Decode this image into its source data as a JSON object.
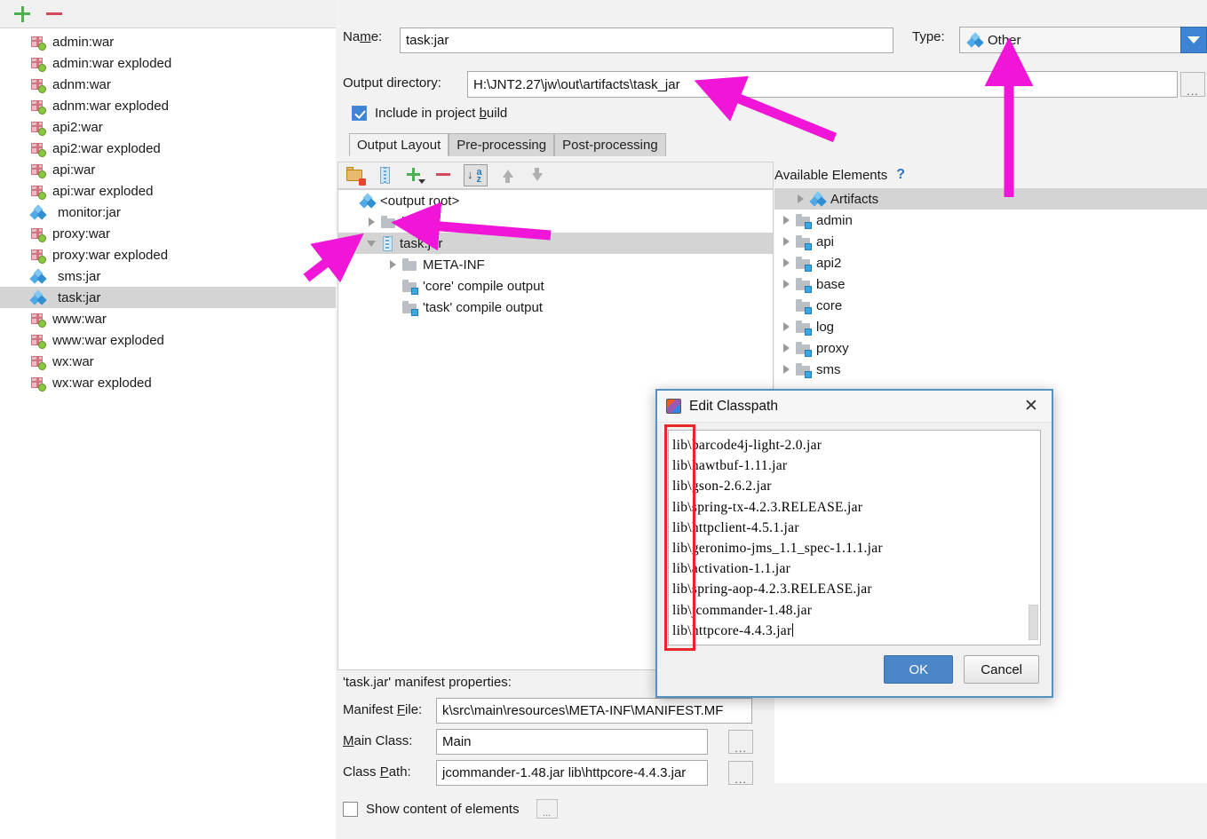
{
  "artifacts_toolbar": {
    "add_label": "+",
    "remove_label": "−"
  },
  "artifacts_list": [
    {
      "label": "admin:war",
      "icon": "war-icon",
      "selected": false
    },
    {
      "label": "admin:war exploded",
      "icon": "war-icon",
      "selected": false
    },
    {
      "label": "adnm:war",
      "icon": "war-icon",
      "selected": false
    },
    {
      "label": "adnm:war exploded",
      "icon": "war-icon",
      "selected": false
    },
    {
      "label": "api2:war",
      "icon": "war-icon",
      "selected": false
    },
    {
      "label": "api2:war exploded",
      "icon": "war-icon",
      "selected": false
    },
    {
      "label": "api:war",
      "icon": "war-icon",
      "selected": false
    },
    {
      "label": "api:war exploded",
      "icon": "war-icon",
      "selected": false
    },
    {
      "label": "monitor:jar",
      "icon": "jar-icon",
      "selected": false
    },
    {
      "label": "proxy:war",
      "icon": "war-icon",
      "selected": false
    },
    {
      "label": "proxy:war exploded",
      "icon": "war-icon",
      "selected": false
    },
    {
      "label": "sms:jar",
      "icon": "jar-icon",
      "selected": false
    },
    {
      "label": "task:jar",
      "icon": "jar-icon",
      "selected": true
    },
    {
      "label": "www:war",
      "icon": "war-icon",
      "selected": false
    },
    {
      "label": "www:war exploded",
      "icon": "war-icon",
      "selected": false
    },
    {
      "label": "wx:war",
      "icon": "war-icon",
      "selected": false
    },
    {
      "label": "wx:war exploded",
      "icon": "war-icon",
      "selected": false
    }
  ],
  "form": {
    "name_label": "Name:",
    "name_value": "task:jar",
    "type_label": "Type:",
    "type_value": "Other",
    "output_dir_label": "Output directory:",
    "output_dir_value": "H:\\JNT2.27\\jw\\out\\artifacts\\task_jar",
    "browse_label": "...",
    "include_in_build_label": "Include in project build",
    "include_in_build_checked": true
  },
  "tabs": [
    {
      "label": "Output Layout",
      "active": true
    },
    {
      "label": "Pre-processing",
      "active": false
    },
    {
      "label": "Post-processing",
      "active": false
    }
  ],
  "layout_toolbar": [
    {
      "name": "create-directory-icon",
      "title": "Create Directory"
    },
    {
      "name": "create-archive-icon",
      "title": "Create Archive"
    },
    {
      "name": "add-icon",
      "title": "Add Copy of"
    },
    {
      "name": "remove-icon",
      "title": "Remove"
    },
    {
      "name": "sort-alphabetically-icon",
      "title": "Sort by Name"
    },
    {
      "name": "move-up-icon",
      "title": "Move Up"
    },
    {
      "name": "move-down-icon",
      "title": "Move Down"
    }
  ],
  "output_layout_tree": [
    {
      "label": "<output root>",
      "icon": "artifact-icon",
      "indent": 0,
      "twisty": "none",
      "selected": false
    },
    {
      "label": "lib",
      "icon": "folder-icon",
      "indent": 1,
      "twisty": "closed",
      "selected": false
    },
    {
      "label": "task.jar",
      "icon": "archive-icon",
      "indent": 1,
      "twisty": "open",
      "selected": true
    },
    {
      "label": "META-INF",
      "icon": "folder-icon",
      "indent": 2,
      "twisty": "closed",
      "selected": false
    },
    {
      "label": "'core' compile output",
      "icon": "module-output-icon",
      "indent": 2,
      "twisty": "none",
      "selected": false
    },
    {
      "label": "'task' compile output",
      "icon": "module-output-icon",
      "indent": 2,
      "twisty": "none",
      "selected": false
    }
  ],
  "available_elements": {
    "title": "Available Elements",
    "help_label": "?",
    "items": [
      {
        "label": "Artifacts",
        "icon": "artifact-icon",
        "twisty": "closed",
        "selected": true
      },
      {
        "label": "admin",
        "icon": "module-output-icon",
        "twisty": "closed",
        "selected": false
      },
      {
        "label": "api",
        "icon": "module-output-icon",
        "twisty": "closed",
        "selected": false
      },
      {
        "label": "api2",
        "icon": "module-output-icon",
        "twisty": "closed",
        "selected": false
      },
      {
        "label": "base",
        "icon": "module-output-icon",
        "twisty": "closed",
        "selected": false
      },
      {
        "label": "core",
        "icon": "module-output-icon",
        "twisty": "none",
        "selected": false
      },
      {
        "label": "log",
        "icon": "module-output-icon",
        "twisty": "closed",
        "selected": false
      },
      {
        "label": "proxy",
        "icon": "module-output-icon",
        "twisty": "closed",
        "selected": false
      },
      {
        "label": "sms",
        "icon": "module-output-icon",
        "twisty": "closed",
        "selected": false
      }
    ]
  },
  "manifest": {
    "title": "'task.jar' manifest properties:",
    "manifest_file_label": "Manifest File:",
    "manifest_file_value": "k\\src\\main\\resources\\META-INF\\MANIFEST.MF",
    "main_class_label": "Main Class:",
    "main_class_value": "Main",
    "class_path_label": "Class Path:",
    "class_path_value": "jcommander-1.48.jar lib\\httpcore-4.4.3.jar",
    "browse_label": "...",
    "show_content_label": "Show content of elements",
    "show_content_checked": false
  },
  "dialog": {
    "title": "Edit Classpath",
    "close_label": "✕",
    "classpath_entries": [
      "lib\\barcode4j-light-2.0.jar",
      "lib\\hawtbuf-1.11.jar",
      "lib\\gson-2.6.2.jar",
      "lib\\spring-tx-4.2.3.RELEASE.jar",
      "lib\\httpclient-4.5.1.jar",
      "lib\\geronimo-jms_1.1_spec-1.1.1.jar",
      "lib\\activation-1.1.jar",
      "lib\\spring-aop-4.2.3.RELEASE.jar",
      "lib\\jcommander-1.48.jar",
      "lib\\httpcore-4.4.3.jar"
    ],
    "ok_label": "OK",
    "cancel_label": "Cancel"
  },
  "annotations": {
    "highlight_color": "#e8262a",
    "arrow_color": "#f015d7"
  }
}
